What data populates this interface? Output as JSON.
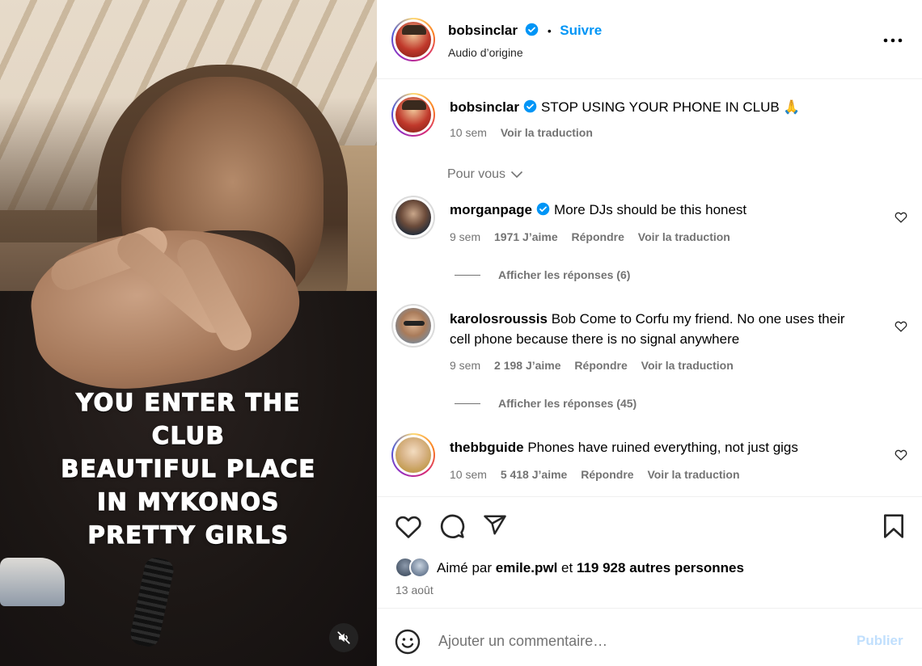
{
  "post": {
    "author": "bobsinclar",
    "follow_label": "Suivre",
    "dot": "•",
    "audio": "Audio d’origine",
    "more_icon": "more-horizontal-icon"
  },
  "video": {
    "overlay_lines": [
      "YOU ENTER THE",
      "CLUB",
      "BEAUTIFUL PLACE",
      "IN MYKONOS",
      "PRETTY GIRLS"
    ],
    "mute_icon": "speaker-muted-icon"
  },
  "caption": {
    "author": "bobsinclar",
    "text": "STOP USING YOUR PHONE IN CLUB 🙏",
    "time": "10 sem",
    "translate": "Voir la traduction"
  },
  "see_more": "Pour vous",
  "comments": [
    {
      "author": "morganpage",
      "verified": true,
      "text": "More DJs should be this honest",
      "time": "9 sem",
      "likes": "1971 J’aime",
      "reply": "Répondre",
      "translate": "Voir la traduction",
      "replies": "Afficher les réponses (6)"
    },
    {
      "author": "karolosroussis",
      "verified": false,
      "text_line1": "Bob Come to Corfu my friend. No one uses their",
      "text_line2": "cell phone because there is no signal anywhere",
      "time": "9 sem",
      "likes": "2 198 J’aime",
      "reply": "Répondre",
      "translate": "Voir la traduction",
      "replies": "Afficher les réponses (45)"
    },
    {
      "author": "thebbguide",
      "verified": false,
      "text": "Phones have ruined everything, not just gigs",
      "time": "10 sem",
      "likes": "5 418 J’aime",
      "reply": "Répondre",
      "translate": "Voir la traduction"
    }
  ],
  "likes": {
    "prefix": "Aimé par",
    "user": "emile.pwl",
    "and": "et",
    "count": "119 928 autres personnes",
    "date": "13 août"
  },
  "composer": {
    "placeholder": "Ajouter un commentaire…",
    "publish": "Publier"
  },
  "colors": {
    "accent": "#0095f6",
    "muted": "#737373",
    "publish_disabled": "#c0dffd"
  }
}
